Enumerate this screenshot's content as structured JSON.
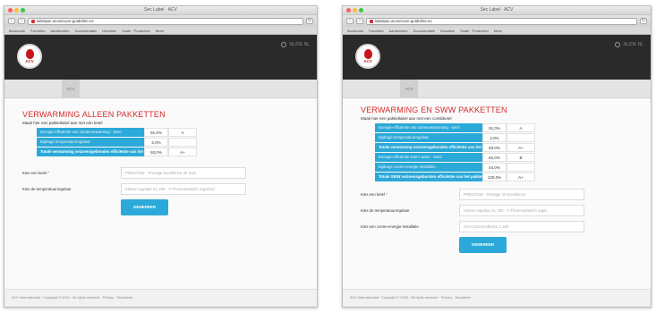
{
  "windows": [
    {
      "window_title": "Sec Label · ACV",
      "url": "labelpac.acvsecure.guideline.ev",
      "bookmarks": [
        "Bookmark",
        "Favorites",
        "Aanbevolen",
        "Documentatie",
        "Deadline",
        "Scale · Producten",
        "More"
      ],
      "language": "NL/DE NL",
      "tab_label": "ACV",
      "page_title": "VERWARMING ALLEEN PAKKETTEN",
      "page_subtitle": "Maak hier een pakketlabel aan met een ketel",
      "rows": [
        {
          "label": "Energie-efficiëntie van ruimteverwarming - ketel",
          "value": "91,0%",
          "cls": "A",
          "bold": false
        },
        {
          "label": "Bijdrage temperatuurregelaar",
          "value": "2,0%",
          "cls": "",
          "bold": false
        },
        {
          "label": "Totale verwarming seizoensgebonden efficiëntie van het pakket",
          "value": "93,0%",
          "cls": "A+",
          "bold": true
        }
      ],
      "fields": [
        {
          "label": "Kies een ketel",
          "required": true,
          "placeholder": "PRESTIGE · Prestige Excellence 32 Solo"
        },
        {
          "label": "Kies de temperatuurregelaar",
          "required": false,
          "placeholder": "Klasse regelaar KL 200 · V Thermostatisch regelend"
        }
      ],
      "generate_label": "GENEREER",
      "footer": "ACV Internationaal · Copyright © 2016 · All rights reserved · Privacy · Disclaimer"
    },
    {
      "window_title": "Sec Label · ACV",
      "url": "labelpac.acvsecure.guideline.ev",
      "bookmarks": [
        "Bookmark",
        "Favorites",
        "Aanbevolen",
        "Documentatie",
        "Deadline",
        "Scale · Producten",
        "More"
      ],
      "language": "NL/DE NL",
      "tab_label": "ACV",
      "page_title": "VERWARMING EN SWW PAKKETTEN",
      "page_subtitle": "Maak hier een pakketlabel aan met een combiketel",
      "rows": [
        {
          "label": "Energie-efficiëntie van ruimteverwarming - ketel",
          "value": "91,0%",
          "cls": "A",
          "bold": false
        },
        {
          "label": "Bijdrage temperatuurregelaar",
          "value": "2,0%",
          "cls": "",
          "bold": false
        },
        {
          "label": "Totale verwarming seizoensgebonden efficiëntie van het pakket",
          "value": "93,0%",
          "cls": "A+",
          "bold": true
        },
        {
          "label": "Energie-efficiëntie warm water - ketel",
          "value": "82,0%",
          "cls": "B",
          "bold": false
        },
        {
          "label": "Bijdrage zonne-energie-installatie",
          "value": "44,0%",
          "cls": "",
          "bold": false
        },
        {
          "label": "Totale SWW seizoensgebonden efficiëntie van het pakket",
          "value": "130,0%",
          "cls": "A+",
          "bold": true
        }
      ],
      "fields": [
        {
          "label": "Kies een ketel",
          "required": true,
          "placeholder": "PRESTIGE · Prestige 32 Excellence"
        },
        {
          "label": "Kies de temperatuurregelaar",
          "required": false,
          "placeholder": "Klasse regelaar KL 200 · V Thermostatisch regel."
        },
        {
          "label": "Kies een zonne-energie-installatie",
          "required": false,
          "placeholder": "ACV Zonnecollector 2.150"
        }
      ],
      "generate_label": "GENEREER",
      "footer": "ACV Internationaal · Copyright © 2016 · All rights reserved · Privacy · Disclaimer"
    }
  ]
}
